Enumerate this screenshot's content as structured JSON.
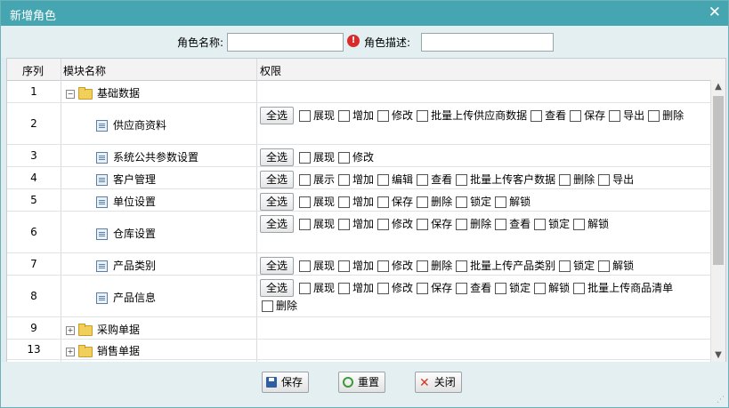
{
  "dialog": {
    "title": "新增角色",
    "close_glyph": "✕"
  },
  "form": {
    "role_name_label": "角色名称:",
    "role_name_value": "",
    "role_desc_label": "角色描述:",
    "role_desc_value": "",
    "warning_glyph": "!"
  },
  "grid": {
    "headers": [
      "序列",
      "模块名称",
      "权限"
    ],
    "select_all_label": "全选",
    "rows": [
      {
        "num": "1",
        "name": "基础数据",
        "type": "folder-open",
        "perms": []
      },
      {
        "num": "2",
        "name": "供应商资料",
        "type": "doc",
        "perms": [
          "展现",
          "增加",
          "修改",
          "批量上传供应商数据",
          "查看",
          "保存",
          "导出",
          "删除"
        ]
      },
      {
        "num": "3",
        "name": "系统公共参数设置",
        "type": "doc",
        "perms": [
          "展现",
          "修改"
        ]
      },
      {
        "num": "4",
        "name": "客户管理",
        "type": "doc",
        "perms": [
          "展示",
          "增加",
          "编辑",
          "查看",
          "批量上传客户数据",
          "删除",
          "导出"
        ]
      },
      {
        "num": "5",
        "name": "单位设置",
        "type": "doc",
        "perms": [
          "展现",
          "增加",
          "保存",
          "删除",
          "锁定",
          "解锁"
        ]
      },
      {
        "num": "6",
        "name": "仓库设置",
        "type": "doc",
        "perms": [
          "展现",
          "增加",
          "修改",
          "保存",
          "删除",
          "查看",
          "锁定",
          "解锁"
        ]
      },
      {
        "num": "7",
        "name": "产品类别",
        "type": "doc",
        "perms": [
          "展现",
          "增加",
          "修改",
          "删除",
          "批量上传产品类别",
          "锁定",
          "解锁"
        ]
      },
      {
        "num": "8",
        "name": "产品信息",
        "type": "doc",
        "perms": [
          "展现",
          "增加",
          "修改",
          "保存",
          "查看",
          "锁定",
          "解锁",
          "批量上传商品清单",
          "删除"
        ]
      },
      {
        "num": "9",
        "name": "采购单据",
        "type": "folder-closed",
        "perms": []
      },
      {
        "num": "13",
        "name": "销售单据",
        "type": "folder-closed",
        "perms": []
      }
    ]
  },
  "footer": {
    "save_label": "保存",
    "reset_label": "重置",
    "close_label": "关闭"
  }
}
